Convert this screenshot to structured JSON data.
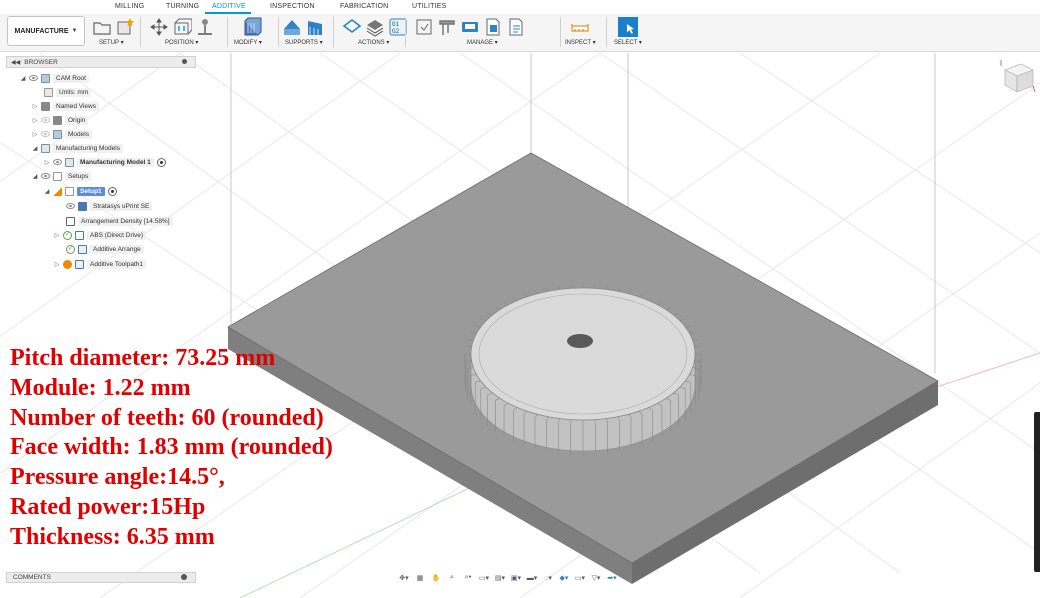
{
  "tabs": [
    "MILLING",
    "TURNING",
    "ADDITIVE",
    "INSPECTION",
    "FABRICATION",
    "UTILITIES"
  ],
  "workspace": {
    "label": "MANUFACTURE"
  },
  "toolbar_groups": {
    "setup": "SETUP",
    "position": "POSITION",
    "modify": "MODIFY",
    "supports": "SUPPORTS",
    "actions": "ACTIONS",
    "manage": "MANAGE",
    "inspect": "INSPECT",
    "select": "SELECT"
  },
  "browser": {
    "title": "BROWSER",
    "items": [
      "CAM Root",
      "Units: mm",
      "Named Views",
      "Origin",
      "Models",
      "Manufacturing Models",
      "Manufacturing Model 1",
      "Setups",
      "Setup1",
      "Stratasys uPrint SE",
      "Arrangement Density [14.58%]",
      "ABS (Direct Drive)",
      "Additive Arrange",
      "Additive Toolpath1"
    ]
  },
  "overlay_text": [
    "Pitch diameter: 73.25 mm",
    "Module: 1.22 mm",
    "Number of teeth: 60 (rounded)",
    "Face width: 1.83 mm (rounded)",
    "Pressure angle:14.5°,",
    "Rated power:15Hp",
    "Thickness: 6.35 mm"
  ],
  "comments": {
    "title": "COMMENTS"
  },
  "colors": {
    "accent": "#0696d7",
    "overlay_text": "#e00000",
    "plate": "#8f8f8f",
    "selected": "#5a8fd6"
  },
  "icons": [
    "setup-icon",
    "new-setup-icon",
    "move-icon",
    "place-icon",
    "orient-icon",
    "modify-icon",
    "supports-icon",
    "actions-icon",
    "nc-code-icon",
    "manage-icon",
    "inspect-icon",
    "select-icon",
    "viewcube-icon"
  ]
}
